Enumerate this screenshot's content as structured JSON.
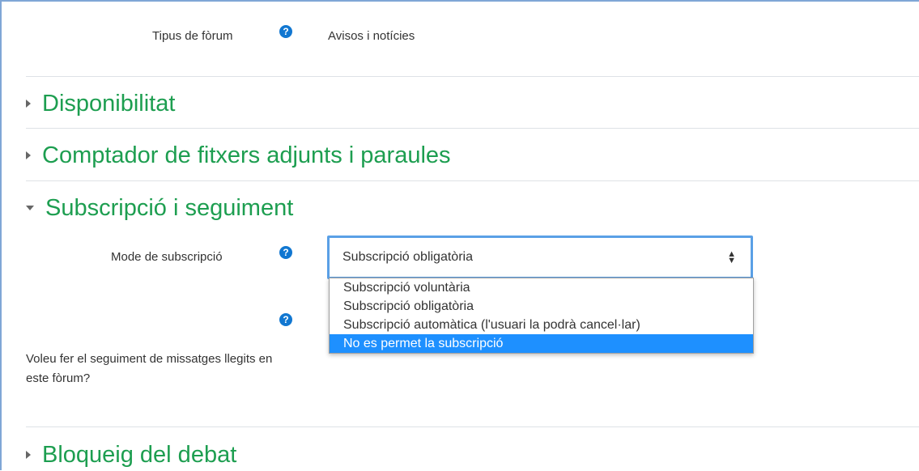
{
  "forum_type": {
    "label": "Tipus de fòrum",
    "value": "Avisos i notícies"
  },
  "sections": {
    "availability": "Disponibilitat",
    "attachments": "Comptador de fitxers adjunts i paraules",
    "subscription": "Subscripció i seguiment",
    "locking": "Bloqueig del debat"
  },
  "subscription_mode": {
    "label": "Mode de subscripció",
    "selected": "Subscripció obligatòria",
    "options": [
      "Subscripció voluntària",
      "Subscripció obligatòria",
      "Subscripció automàtica (l'usuari la podrà cancel·lar)",
      "No es permet la subscripció"
    ],
    "highlighted_index": 3
  },
  "read_tracking": {
    "label": "Voleu fer el seguiment de missatges llegits en este fòrum?"
  },
  "icons": {
    "help": "?",
    "select_arrows": "▲▼"
  },
  "colors": {
    "section_title": "#1d9e50",
    "help_icon": "#1177d1",
    "select_focus_border": "#5aa0e6",
    "option_highlight": "#1e90ff"
  }
}
